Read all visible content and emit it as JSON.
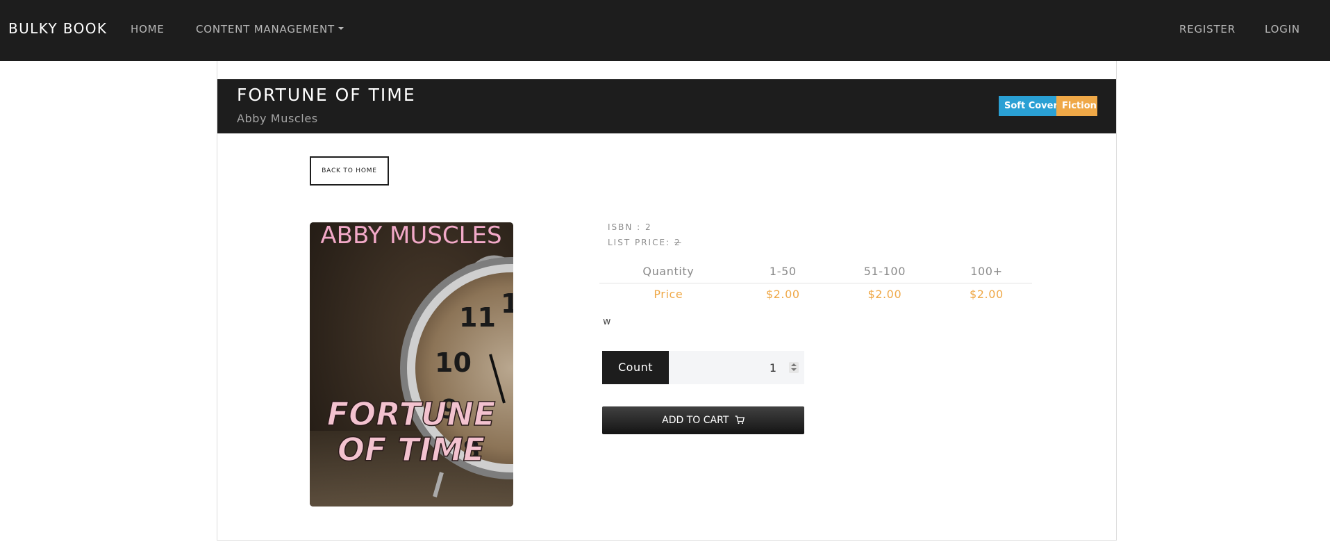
{
  "nav": {
    "brand": "BULKY BOOK",
    "home": "HOME",
    "content_management": "CONTENT MANAGEMENT",
    "register": "REGISTER",
    "login": "LOGIN"
  },
  "product": {
    "title": "FORTUNE OF TIME",
    "author": "Abby Muscles",
    "badges": [
      {
        "label": "Soft Cover",
        "color": "#2aa0d4"
      },
      {
        "label": "Fiction",
        "color": "#efa847"
      }
    ],
    "back_label": "BACK TO HOME",
    "cover": {
      "top_text": "ABBY MUSCLES",
      "title_line1": "FORTUNE",
      "title_line2": "OF TIME"
    },
    "isbn_label": "ISBN : 2",
    "list_price_label": "LIST PRICE:",
    "list_price_value": "2",
    "price_table": {
      "headers": [
        "Quantity",
        "1-50",
        "51-100",
        "100+"
      ],
      "prices": [
        "Price",
        "$2.00",
        "$2.00",
        "$2.00"
      ]
    },
    "description": "w",
    "count_label": "Count",
    "count_value": "1",
    "add_to_cart": "ADD TO CART"
  },
  "colors": {
    "navbar": "#1d1d1d",
    "accent_orange": "#efa847",
    "accent_blue": "#2aa0d4"
  }
}
